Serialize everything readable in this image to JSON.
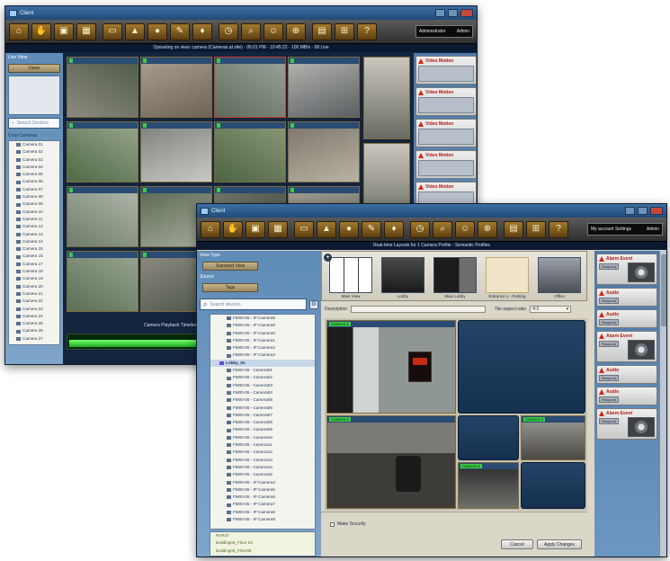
{
  "back_window": {
    "title": "Client",
    "status": "Operating on view: camera (Cameras at site) · 05:01 PM · 10:45:22 · 100 MB/s · 98 Live",
    "account": {
      "user": "Administrator",
      "role": "Admin"
    },
    "left": {
      "view_label": "Live View",
      "button": "Views",
      "search_placeholder": "Search Devices",
      "tree_header": "Corp Cameras",
      "tree_items": [
        "Camera 01",
        "Camera 02",
        "Camera 03",
        "Camera 04",
        "Camera 05",
        "Camera 06",
        "Camera 07",
        "Camera 08",
        "Camera 09",
        "Camera 10",
        "Camera 11",
        "Camera 12",
        "Camera 13",
        "Camera 14",
        "Camera 15",
        "Camera 16",
        "Camera 17",
        "Camera 18",
        "Camera 19",
        "Camera 20",
        "Camera 21",
        "Camera 22",
        "Camera 23",
        "Camera 24",
        "Camera 25",
        "Camera 26",
        "Camera 27",
        "Camera 28",
        "Camera 29",
        "Camera 30"
      ]
    },
    "timeline_label": "Camera Playback Timeline",
    "alarms": [
      "Video Motion",
      "Video Motion",
      "Video Motion",
      "Video Motion",
      "Video Motion"
    ]
  },
  "front_window": {
    "title": "Client",
    "status": "Real-time Layouts for 1 Camera Profile - Semantic Profiles",
    "account": {
      "user": "My account Settings",
      "role": "Admin"
    },
    "left": {
      "view_type_label": "View Type",
      "view_type_button": "Standard View",
      "source_label": "Source",
      "source_button": "Tags",
      "search_placeholder": "Search devices",
      "tree": [
        {
          "label": "FM00-05 - IP Camera8",
          "group": false
        },
        {
          "label": "FM00-05 - IP Camera9",
          "group": false
        },
        {
          "label": "FM00-05 - IP Camera0",
          "group": false
        },
        {
          "label": "FM00-05 - IP Camera1",
          "group": false
        },
        {
          "label": "FM00-05 - IP Camera2",
          "group": false
        },
        {
          "label": "FM00-05 - IP Camera3",
          "group": false
        },
        {
          "label": "Lobby_01",
          "group": true
        },
        {
          "label": "FM00-05 - Camera01",
          "group": false
        },
        {
          "label": "FM00-05 - Camera02",
          "group": false
        },
        {
          "label": "FM00-05 - Camera03",
          "group": false
        },
        {
          "label": "FM00-05 - Camera04",
          "group": false
        },
        {
          "label": "FM00-05 - Camera05",
          "group": false
        },
        {
          "label": "FM00-05 - Camera06",
          "group": false
        },
        {
          "label": "FM00-05 - Camera07",
          "group": false
        },
        {
          "label": "FM00-05 - Camera08",
          "group": false
        },
        {
          "label": "FM00-05 - Camera09",
          "group": false
        },
        {
          "label": "FM00-05 - Camera10",
          "group": false
        },
        {
          "label": "FM00-05 - Camera11",
          "group": false
        },
        {
          "label": "FM00-05 - Camera12",
          "group": false
        },
        {
          "label": "FM00-05 - Camera13",
          "group": false
        },
        {
          "label": "FM00-05 - Camera14",
          "group": false
        },
        {
          "label": "FM00-05 - Camera15",
          "group": false
        },
        {
          "label": "FM00-05 - IP Camera4",
          "group": false
        },
        {
          "label": "FM00-05 - IP Camera5",
          "group": false
        },
        {
          "label": "FM00-05 - IP Camera6",
          "group": false
        },
        {
          "label": "FM00-05 - IP Camera7",
          "group": false
        },
        {
          "label": "FM00-05 - IP Camera8",
          "group": false
        },
        {
          "label": "FM00-05 - IP Camera9",
          "group": false
        }
      ],
      "bottom_items": [
        "NVR47",
        "Building03_Floor 04",
        "Building03_Floor05"
      ]
    },
    "layouts": [
      {
        "name": "Main View",
        "selected": false
      },
      {
        "name": "Lobby",
        "selected": false
      },
      {
        "name": "Main Lobby",
        "selected": false
      },
      {
        "name": "Entrance 1 - Parking",
        "selected": true
      },
      {
        "name": "Office",
        "selected": false
      }
    ],
    "description_label": "Description",
    "tile_aspect_label": "Tile aspect ratio",
    "tile_aspect_value": "4:3",
    "video_tiles": [
      {
        "label": "Camera 1"
      },
      {
        "label": "Camera 2"
      },
      {
        "label": "Camera 3"
      },
      {
        "label": "Camera 4"
      }
    ],
    "checkbox_label": "Make Security",
    "cancel_button": "Cancel",
    "apply_button": "Apply Changes",
    "alarms": [
      {
        "title": "Alarm Event",
        "type": "Video Motion"
      },
      {
        "title": "Audio",
        "type": "Audio"
      },
      {
        "title": "Audio",
        "type": "Audio"
      },
      {
        "title": "Alarm Event",
        "type": "Video Motion"
      },
      {
        "title": "Audio",
        "type": "Audio"
      },
      {
        "title": "Audio",
        "type": "Audio"
      },
      {
        "title": "Alarm Event",
        "type": "Video Motion"
      }
    ],
    "alarm_button": "Respond"
  }
}
